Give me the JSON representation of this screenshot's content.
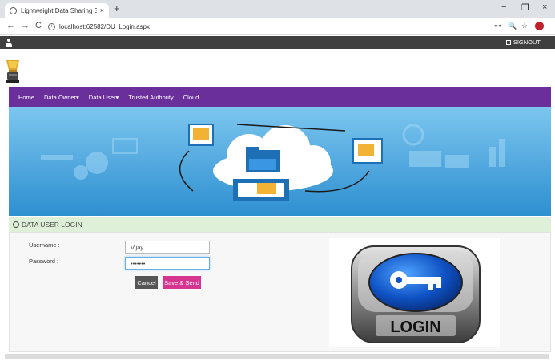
{
  "browser": {
    "tab_title": "Lightweight Data Sharing Schem",
    "tab_close": "×",
    "new_tab": "+",
    "minimize": "−",
    "restore": "❐",
    "window_close": "×",
    "back": "←",
    "forward": "→",
    "reload": "C",
    "url": "localhost:62582/DU_Login.aspx",
    "ext_key": "⊶",
    "ext_zoom": "🔍",
    "ext_star": "☆",
    "menu": "⋮"
  },
  "topbar": {
    "signout_label": "SIGNOUT"
  },
  "nav": {
    "items": [
      "Home",
      "Data Owner▾",
      "Data User▾",
      "Trusted Authority",
      "Cloud"
    ]
  },
  "section": {
    "title": "DATA USER LOGIN"
  },
  "form": {
    "username_label": "Username :",
    "password_label": "Password :",
    "username_value": "Vijay",
    "password_value": "•••••••",
    "cancel_label": "Cancel",
    "save_label": "Save & Send"
  },
  "login_image": {
    "text": "LOGIN"
  },
  "colors": {
    "nav_bg": "#6a2f9a",
    "topbar_bg": "#3f3f3f",
    "section_bg": "#dff0d8",
    "save_btn": "#d5358f",
    "banner_sky": "#3fa6e0"
  }
}
